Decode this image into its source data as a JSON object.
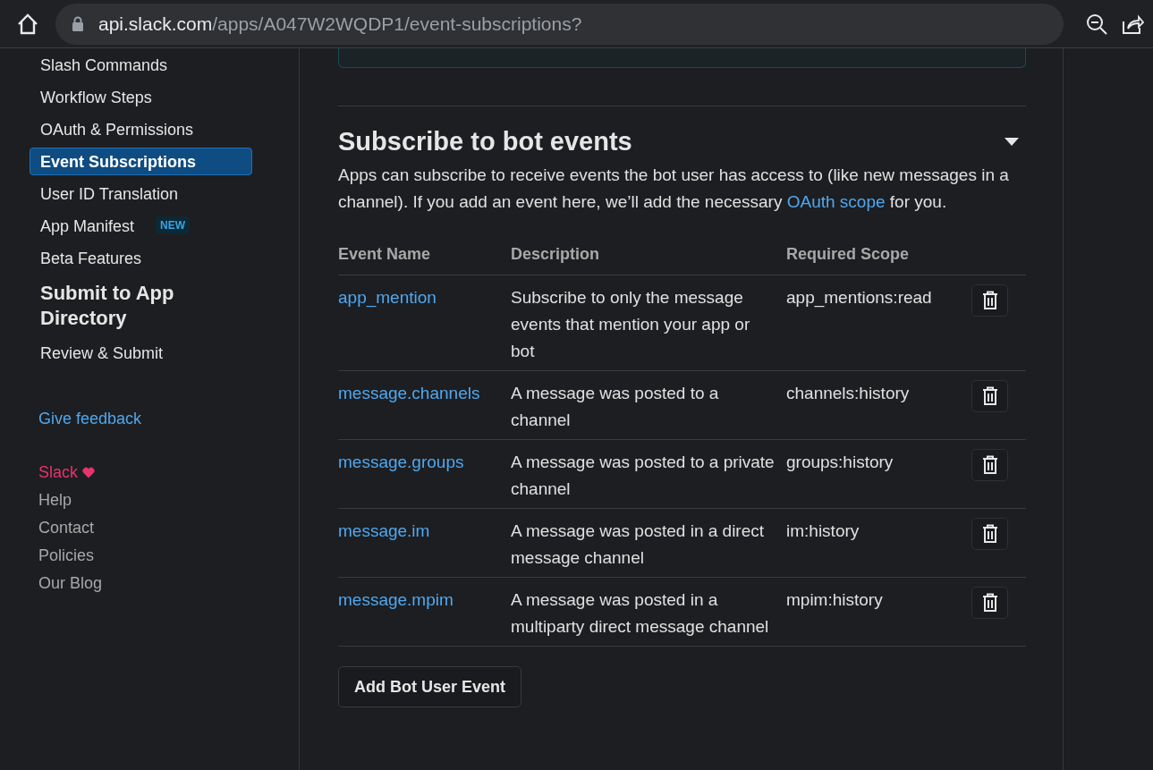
{
  "browser": {
    "host": "api.slack.com",
    "path": "/apps/A047W2WQDP1/event-subscriptions?"
  },
  "sidebar": {
    "items": [
      {
        "label": "Slash Commands",
        "selected": false
      },
      {
        "label": "Workflow Steps",
        "selected": false
      },
      {
        "label": "OAuth & Permissions",
        "selected": false
      },
      {
        "label": "Event Subscriptions",
        "selected": true
      },
      {
        "label": "User ID Translation",
        "selected": false
      },
      {
        "label": "App Manifest",
        "selected": false,
        "badge": "NEW"
      },
      {
        "label": "Beta Features",
        "selected": false
      }
    ],
    "section_title": "Submit to App Directory",
    "section_items": [
      {
        "label": "Review & Submit",
        "selected": false
      }
    ],
    "feedback_link": "Give feedback",
    "footer_links": [
      {
        "label": "Slack",
        "kind": "brand",
        "color": "#e8336b"
      },
      {
        "label": "Help",
        "kind": "link"
      },
      {
        "label": "Contact",
        "kind": "link"
      },
      {
        "label": "Policies",
        "kind": "link"
      },
      {
        "label": "Our Blog",
        "kind": "link"
      }
    ]
  },
  "section": {
    "title": "Subscribe to bot events",
    "expanded": true,
    "description": [
      {
        "text": "Apps can subscribe to receive events the bot user has access to (like new messages in a channel). If you add an event here, we’ll add the necessary ",
        "kind": "text"
      },
      {
        "text": "OAuth scope",
        "kind": "link"
      },
      {
        "text": " for you.",
        "kind": "text"
      }
    ],
    "table": {
      "columns": [
        "Event Name",
        "Description",
        "Required Scope"
      ],
      "rows": [
        {
          "event": "app_mention",
          "description": "Subscribe to only the message events that mention your app or bot",
          "scope": "app_mentions:read"
        },
        {
          "event": "message.channels",
          "description": "A message was posted to a channel",
          "scope": "channels:history"
        },
        {
          "event": "message.groups",
          "description": "A message was posted to a private channel",
          "scope": "groups:history"
        },
        {
          "event": "message.im",
          "description": "A message was posted in a direct message channel",
          "scope": "im:history"
        },
        {
          "event": "message.mpim",
          "description": "A message was posted in a multiparty direct message channel",
          "scope": "mpim:history"
        }
      ]
    },
    "add_button": "Add Bot User Event"
  }
}
